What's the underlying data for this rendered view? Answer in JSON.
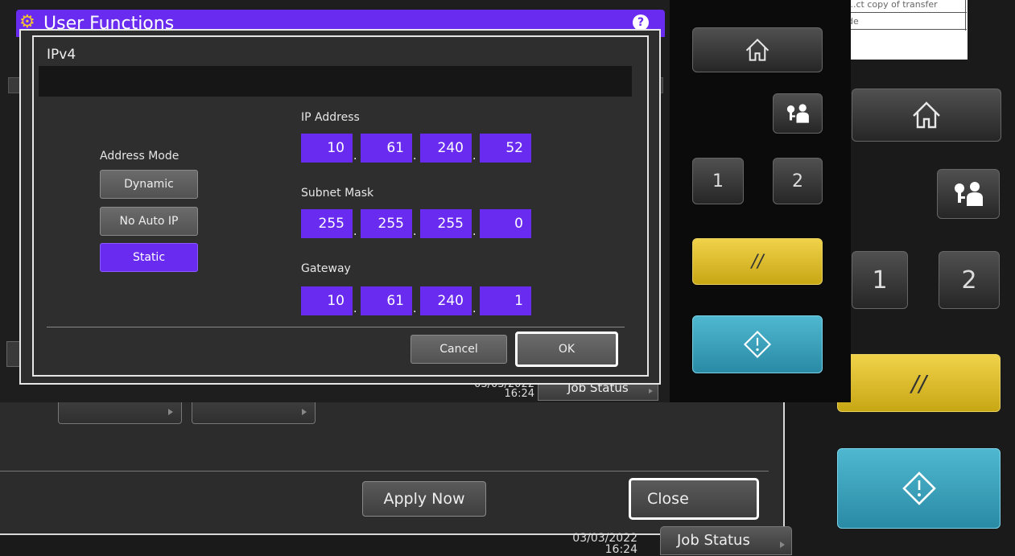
{
  "back": {
    "doc_row1": "...ct copy of transfer",
    "doc_row2": "de",
    "apply_label": "Apply Now",
    "close_label": "Close",
    "date": "03/03/2022",
    "time": "16:24",
    "job_status_label": "Job Status"
  },
  "right_keys": {
    "one": "1",
    "two": "2",
    "clear_symbol": "//"
  },
  "middle": {
    "title": "User Functions",
    "help": "?",
    "date": "03/03/2022",
    "time": "16:24",
    "job_status_label": "Job Status"
  },
  "side_keys": {
    "one": "1",
    "two": "2",
    "clear_symbol": "//"
  },
  "dialog": {
    "title": "IPv4",
    "address_mode_label": "Address Mode",
    "modes": [
      "Dynamic",
      "No Auto IP",
      "Static"
    ],
    "selected_mode": "Static",
    "ip_label": "IP Address",
    "ip": [
      "10",
      "61",
      "240",
      "52"
    ],
    "subnet_label": "Subnet Mask",
    "subnet": [
      "255",
      "255",
      "255",
      "0"
    ],
    "gateway_label": "Gateway",
    "gateway": [
      "10",
      "61",
      "240",
      "1"
    ],
    "cancel_label": "Cancel",
    "ok_label": "OK"
  },
  "colors": {
    "accent_purple": "#6a2bf0",
    "clear_yellow": "#e0c12c",
    "start_teal": "#3aa0bb"
  },
  "icons": [
    "gear-icon",
    "help-icon",
    "home-icon",
    "user-login-icon",
    "start-icon"
  ]
}
